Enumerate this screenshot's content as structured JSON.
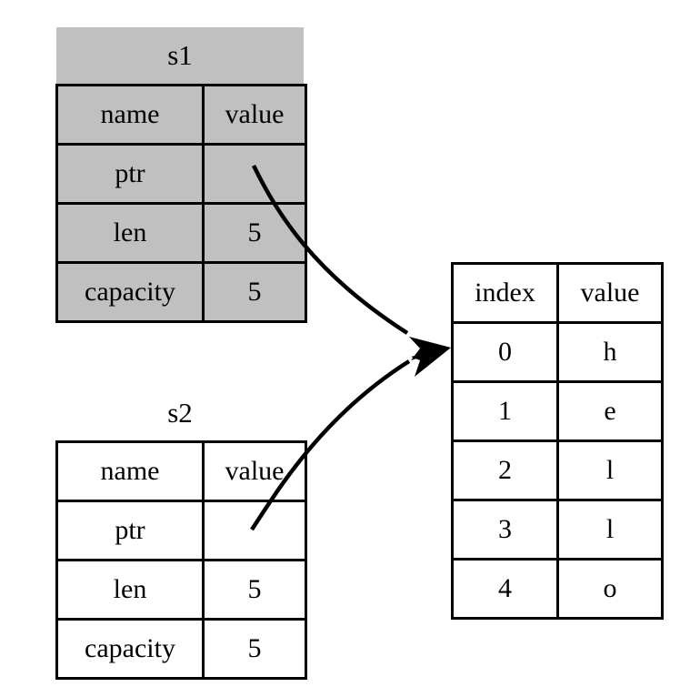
{
  "diagram": {
    "title_s1": "s1",
    "title_s2": "s2",
    "background_color": "#ffffff",
    "stroke_color": "#000000",
    "s1_fill_color": "#c0c0c0",
    "s2_fill_color": "#ffffff"
  },
  "s1": {
    "label": "s1",
    "header": {
      "name": "name",
      "value": "value"
    },
    "rows": [
      {
        "name": "ptr",
        "value": ""
      },
      {
        "name": "len",
        "value": "5"
      },
      {
        "name": "capacity",
        "value": "5"
      }
    ]
  },
  "s2": {
    "label": "s2",
    "header": {
      "name": "name",
      "value": "value"
    },
    "rows": [
      {
        "name": "ptr",
        "value": ""
      },
      {
        "name": "len",
        "value": "5"
      },
      {
        "name": "capacity",
        "value": "5"
      }
    ]
  },
  "heap": {
    "header": {
      "index": "index",
      "value": "value"
    },
    "rows": [
      {
        "index": "0",
        "value": "h"
      },
      {
        "index": "1",
        "value": "e"
      },
      {
        "index": "2",
        "value": "l"
      },
      {
        "index": "3",
        "value": "l"
      },
      {
        "index": "4",
        "value": "o"
      }
    ]
  },
  "pointers": [
    {
      "from": "s1.ptr",
      "to": "heap.row0",
      "kind": "curved-arrow"
    },
    {
      "from": "s2.ptr",
      "to": "heap.row0",
      "kind": "curved-arrow"
    }
  ]
}
